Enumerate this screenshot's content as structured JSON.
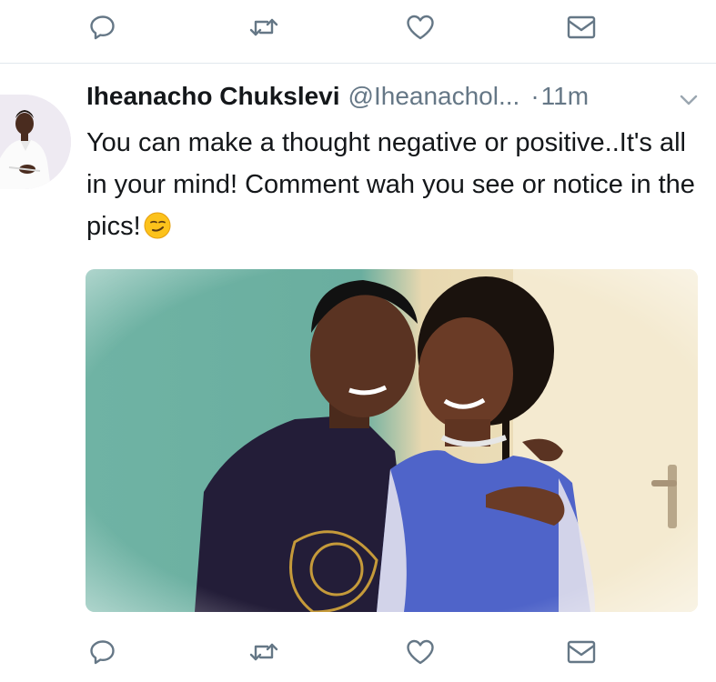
{
  "tweet": {
    "author_name": "Iheanacho Chukslevi",
    "handle": "@Iheanachol...",
    "dot": "·",
    "time": "11m",
    "text": "You can make a thought negative or positive..It's all in your mind! Comment wah you see or notice in the pics!",
    "emoji": "smirking-face"
  },
  "icons": {
    "reply": "reply-icon",
    "retweet": "retweet-icon",
    "like": "like-icon",
    "dm": "direct-message-icon",
    "caret": "chevron-down-icon"
  },
  "colors": {
    "text": "#14171a",
    "secondary": "#657786",
    "icon": "#657786",
    "divider": "#e1e8ed"
  }
}
